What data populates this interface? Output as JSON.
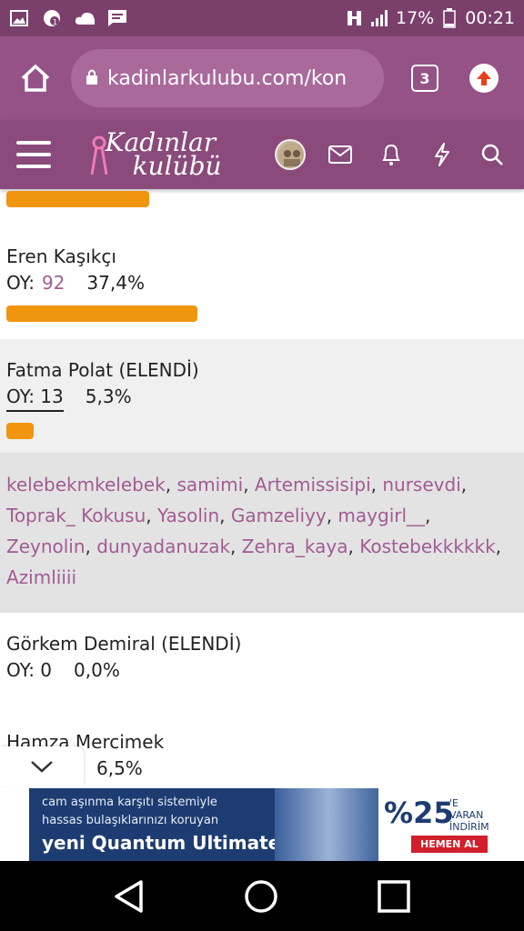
{
  "status_bar": {
    "battery": "17%",
    "time": "00:21"
  },
  "browser": {
    "url": "kadinlarkulubu.com/kon",
    "tab_count": "3"
  },
  "site": {
    "logo_line1": "Kadınlar",
    "logo_line2": "kulübü"
  },
  "poll": [
    {
      "name": "Eren Kaşıkçı",
      "votes_label": "OY:",
      "votes": "92",
      "percent": "37,4%",
      "bar_fraction": 0.374
    },
    {
      "name": "Fatma Polat (ELENDİ)",
      "votes_label": "OY: 13",
      "votes": "",
      "percent": "5,3%",
      "bar_fraction": 0.053
    },
    {
      "name": "Görkem Demiral (ELENDİ)",
      "votes_label": "OY: 0",
      "votes": "",
      "percent": "0,0%",
      "bar_fraction": 0.0
    },
    {
      "name": "Hamza Mercimek",
      "votes_label": "",
      "votes": "",
      "percent": "6,5%",
      "bar_fraction": 0.065
    }
  ],
  "voters": [
    "kelebekmkelebek",
    "samimi",
    "Artemissisipi",
    "nursevdi",
    "Toprak_ Kokusu",
    "Yasolin",
    "Gamzeliyy",
    "maygirl__",
    "Zeynolin",
    "dunyadanuzak",
    "Zehra_kaya",
    "Kostebekkkkkk",
    "Azimliiii"
  ],
  "ad": {
    "line1": "cam aşınma karşıtı sistemiyle",
    "line2": "hassas bulaşıklarınızı koruyan",
    "line3": "yeni Quantum Ultimate!",
    "discount": "%25",
    "discount_note1": "'E VARAN",
    "discount_note2": "İNDİRİM",
    "cta": "HEMEN AL"
  },
  "colors": {
    "status_bar": "#7b3f6c",
    "url_bar": "#955286",
    "nav_bar": "#8a4a7b",
    "poll_bar": "#f0950e",
    "link": "#a15c93"
  }
}
